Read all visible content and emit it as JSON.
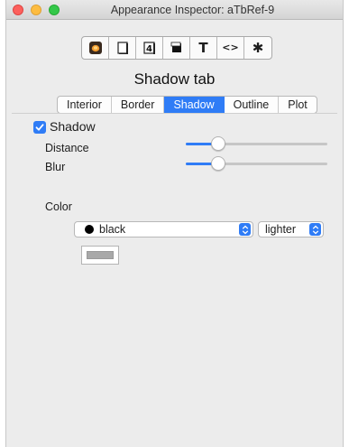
{
  "window": {
    "title": "Appearance Inspector: aTbRef-9"
  },
  "toolbar": {
    "buttons": [
      {
        "name": "general",
        "icon": "app-icon"
      },
      {
        "name": "text-doc",
        "icon": "document-icon"
      },
      {
        "name": "number",
        "icon": "number-icon",
        "label": "4"
      },
      {
        "name": "appearance",
        "icon": "shadow-box-icon"
      },
      {
        "name": "text",
        "icon": "text-icon",
        "label": "T"
      },
      {
        "name": "code",
        "icon": "code-icon",
        "label": "<>"
      },
      {
        "name": "settings",
        "icon": "gear-icon",
        "label": "✱"
      }
    ]
  },
  "heading": "Shadow tab",
  "tabs": [
    {
      "label": "Interior",
      "active": false
    },
    {
      "label": "Border",
      "active": false
    },
    {
      "label": "Shadow",
      "active": true
    },
    {
      "label": "Outline",
      "active": false
    },
    {
      "label": "Plot",
      "active": false
    }
  ],
  "shadow": {
    "checkbox_label": "Shadow",
    "checked": true,
    "distance_label": "Distance",
    "distance_value": 0.23,
    "blur_label": "Blur",
    "blur_value": 0.23,
    "color_label": "Color",
    "color_popup": "black",
    "shade_popup": "lighter"
  },
  "colors": {
    "accent": "#2f7cf6",
    "swatch": "#a8a8a8"
  }
}
